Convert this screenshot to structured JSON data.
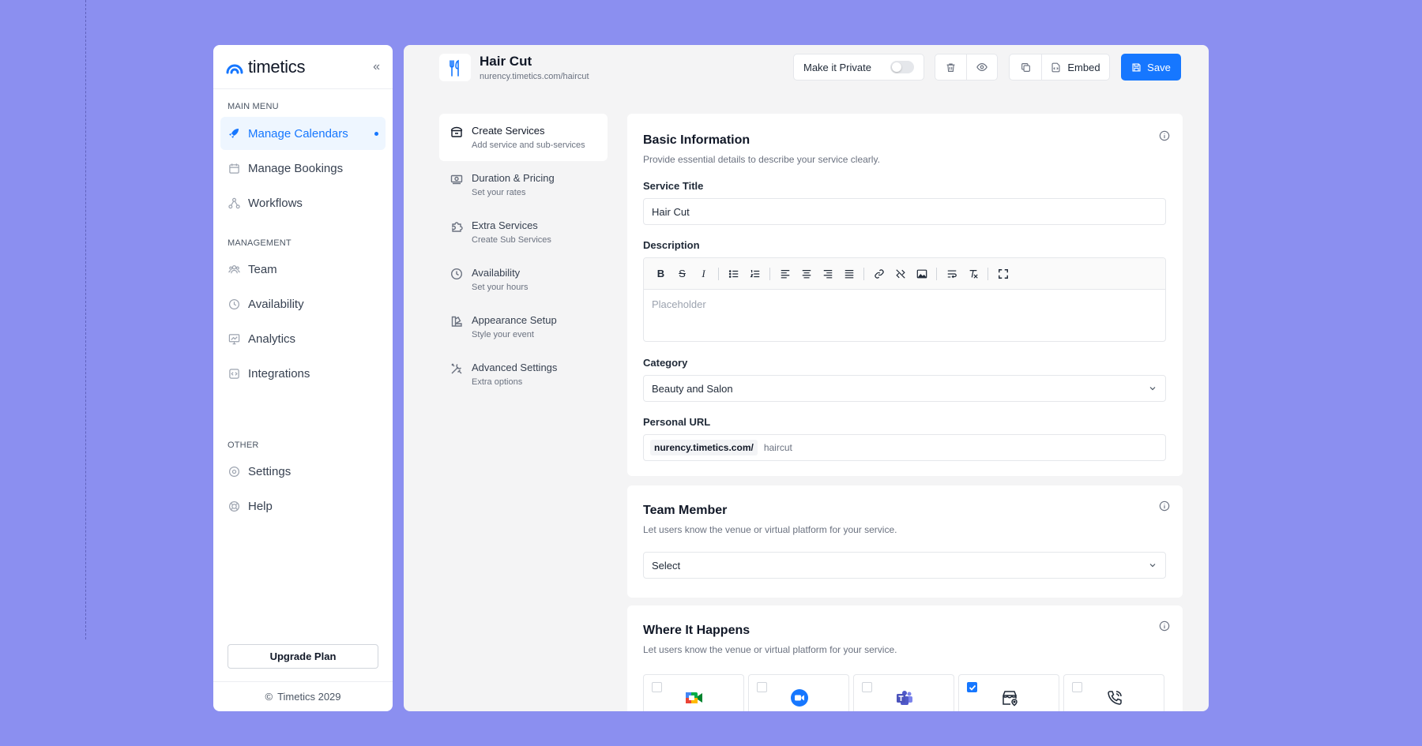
{
  "brand": {
    "name": "timetics",
    "accent": "#1677ff"
  },
  "sidebar": {
    "sections": [
      {
        "label": "MAIN MENU",
        "items": [
          {
            "label": "Manage Calendars",
            "icon": "rocket-icon",
            "active": true
          },
          {
            "label": "Manage Bookings",
            "icon": "calendar-icon"
          },
          {
            "label": "Workflows",
            "icon": "workflow-icon"
          }
        ]
      },
      {
        "label": "MANAGEMENT",
        "items": [
          {
            "label": "Team",
            "icon": "team-icon"
          },
          {
            "label": "Availability",
            "icon": "clock-icon"
          },
          {
            "label": "Analytics",
            "icon": "analytics-icon"
          },
          {
            "label": "Integrations",
            "icon": "integrations-icon"
          }
        ]
      },
      {
        "label": "OTHER",
        "items": [
          {
            "label": "Settings",
            "icon": "settings-icon"
          },
          {
            "label": "Help",
            "icon": "help-icon"
          }
        ]
      }
    ],
    "upgrade_label": "Upgrade Plan",
    "footer": "Timetics 2029"
  },
  "header": {
    "title": "Hair Cut",
    "url": "nurency.timetics.com/haircut",
    "private_label": "Make it Private",
    "embed_label": "Embed",
    "save_label": "Save"
  },
  "steps": [
    {
      "title": "Create Services",
      "sub": "Add service and sub-services",
      "active": true
    },
    {
      "title": "Duration & Pricing",
      "sub": "Set your rates"
    },
    {
      "title": "Extra Services",
      "sub": "Create Sub Services"
    },
    {
      "title": "Availability",
      "sub": "Set your hours"
    },
    {
      "title": "Appearance Setup",
      "sub": "Style your event"
    },
    {
      "title": "Advanced Settings",
      "sub": "Extra options"
    }
  ],
  "basic": {
    "title": "Basic Information",
    "desc": "Provide essential details to describe your service clearly.",
    "service_title_label": "Service Title",
    "service_title_value": "Hair Cut",
    "description_label": "Description",
    "description_placeholder": "Placeholder",
    "category_label": "Category",
    "category_value": "Beauty and Salon",
    "url_label": "Personal URL",
    "url_prefix": "nurency.timetics.com/",
    "url_slug": "haircut"
  },
  "team": {
    "title": "Team Member",
    "desc": "Let users know the venue or virtual platform for your service.",
    "select_value": "Select"
  },
  "where": {
    "title": "Where It Happens",
    "desc": "Let users know the venue or virtual platform for your service.",
    "options": [
      {
        "icon": "google-meet-icon",
        "checked": false
      },
      {
        "icon": "zoom-icon",
        "checked": false
      },
      {
        "icon": "ms-teams-icon",
        "checked": false
      },
      {
        "icon": "in-person-location-icon",
        "checked": true
      },
      {
        "icon": "phone-call-icon",
        "checked": false
      }
    ]
  }
}
